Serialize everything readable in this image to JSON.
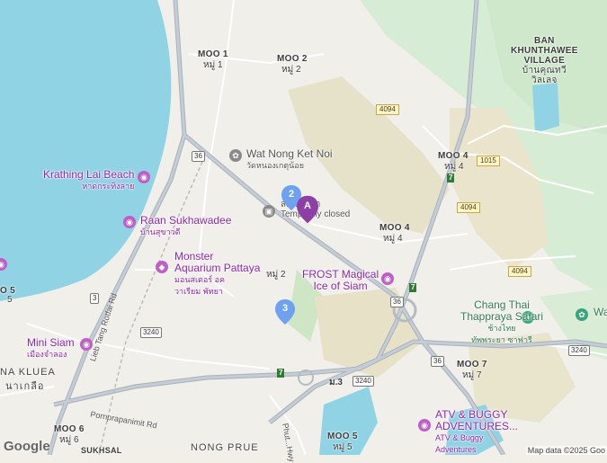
{
  "map": {
    "areas": {
      "moo1": {
        "en": "MOO 1",
        "th": "หมู่ 1"
      },
      "moo2_top": {
        "en": "MOO 2",
        "th": "หมู่ 2"
      },
      "moo4_right": {
        "en": "MOO 4",
        "th": "หมู่ 4"
      },
      "moo4_mid": {
        "en": "MOO 4",
        "th": "หมู่ 4"
      },
      "moo2_mid": {
        "en": "",
        "th": "หมู่ 2"
      },
      "moo5_left": {
        "en": "O 5",
        "th": "5"
      },
      "moo7": {
        "en": "MOO 7",
        "th": "หมู่ 7"
      },
      "moo3": {
        "en": "",
        "th": "ม.3"
      },
      "moo6": {
        "en": "MOO 6",
        "th": "หมู่ 6"
      },
      "moo5_bottom": {
        "en": "MOO 5",
        "th": "หมู่ 5"
      },
      "ban_khunthawee": {
        "line1": "BAN",
        "line2": "KHUNTHAWEE",
        "line3": "VILLAGE",
        "th1": "บ้านคุณทวี",
        "th2": "วิลเลจ"
      },
      "na_kluea": {
        "en": "NA KLUEA",
        "th": "นาเกลือ"
      },
      "nong_prue": "NONG PRUE",
      "sukhsal": "SUKHSAL"
    },
    "pois": {
      "wat_nong_ket_noi": {
        "name": "Wat Nong Ket Noi",
        "th": "วัดหนองเกตุน้อย"
      },
      "krathing_lai": {
        "name": "Krathing Lai Beach",
        "th": "หาดกระทิงลาย"
      },
      "raan_sukhawadee": {
        "name": "Raan Sukhawadee",
        "th": "บ้านสุขาวดี"
      },
      "monster_aquarium": {
        "line1": "Monster",
        "line2": "Aquarium Pattaya",
        "th1": "มอนสเตอร์ อค",
        "th2": "วาเรียม พัทยา"
      },
      "frost": {
        "line1": "FROST Magical",
        "line2": "Ice of Siam"
      },
      "chang_thai": {
        "line1": "Chang Thai",
        "line2": "Thappraya Safari",
        "th1": "ช้างไทย",
        "th2": "ทัพพระยา ซาฟารี"
      },
      "mini_siam": {
        "name": "Mini Siam",
        "th": "เมืองจำลอง"
      },
      "atv": {
        "line1": "ATV & BUGGY",
        "line2": "ADVENTURES...",
        "line3": "ATV & Buggy",
        "line4": "Adventures"
      },
      "temple_closed": {
        "line1": "ส...ร์พัทยา",
        "line2": "Temp...rily closed"
      },
      "wa_edge": "Wa"
    },
    "roads": {
      "r4094_a": "4094",
      "r4094_b": "4094",
      "r4094_c": "4094",
      "r1015": "1015",
      "r36_a": "36",
      "r36_b": "36",
      "r36_c": "36",
      "r3": "3",
      "r3240_a": "3240",
      "r3240_b": "3240",
      "r3240_c": "3240",
      "r7_a": "7",
      "r7_b": "7",
      "r7_c": "7",
      "lieb_tang": "Lieb Tang Rotfai Rd",
      "pornprapanimit": "Pornprapanimit Rd",
      "phutthraksa": "Phut...Hwy"
    },
    "markers": {
      "a": "A",
      "two": "2",
      "three": "3"
    },
    "google": "Google",
    "attribution": "Map data ©2025 Goo"
  }
}
